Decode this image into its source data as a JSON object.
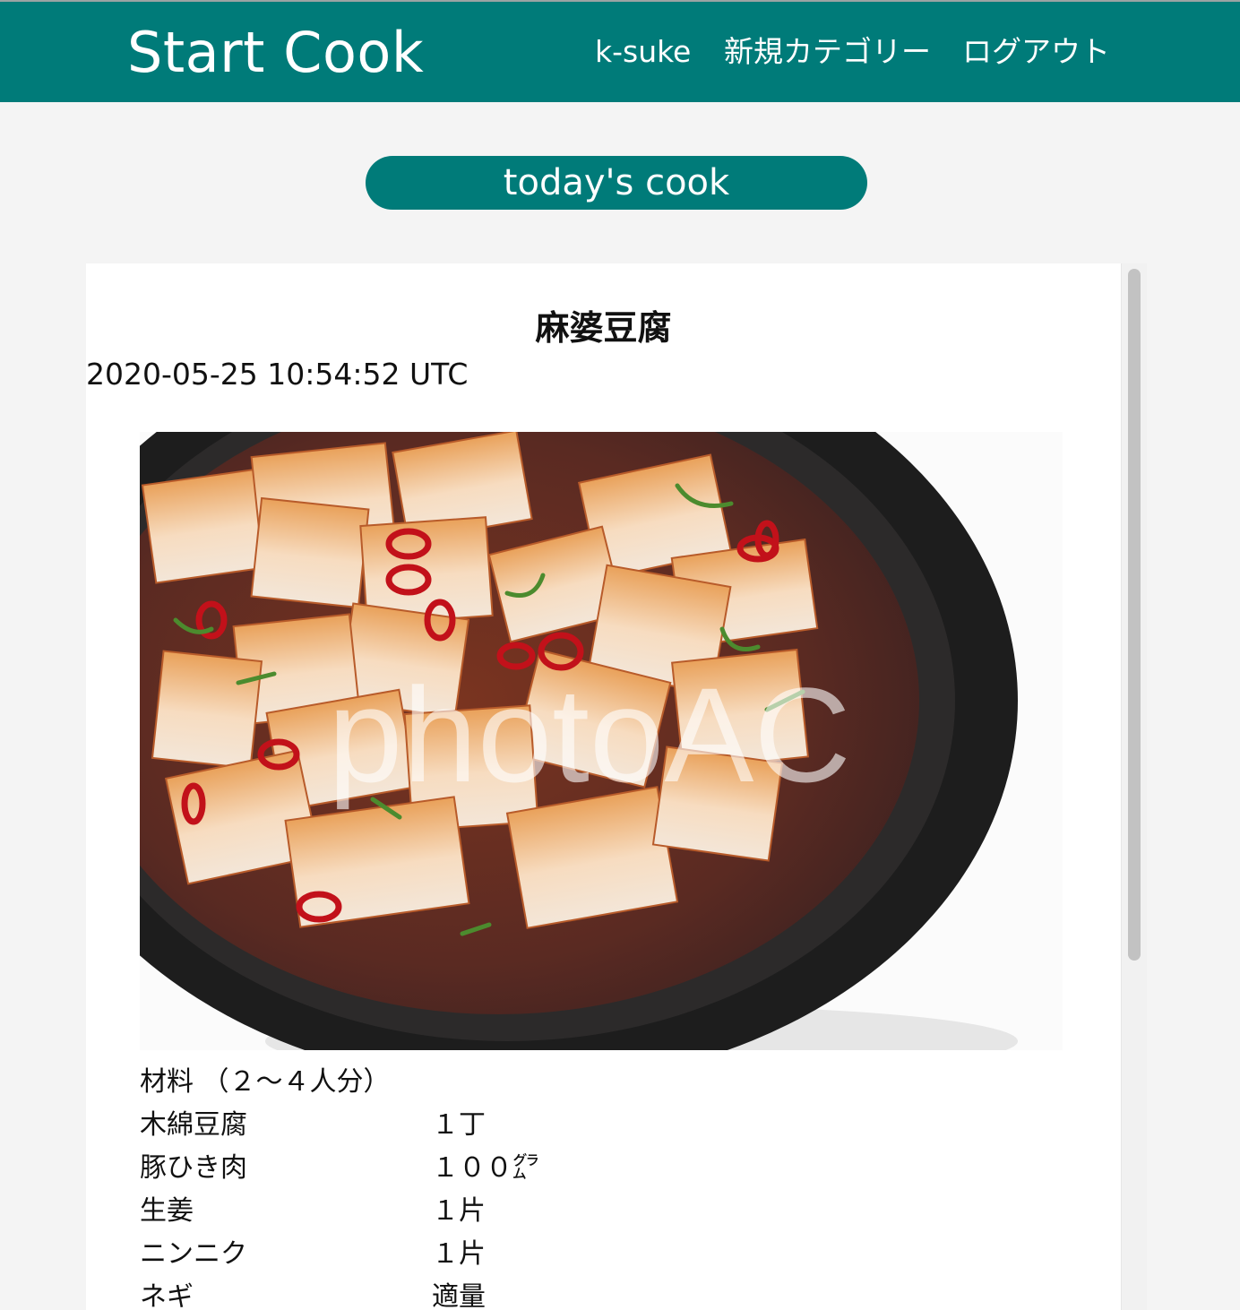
{
  "header": {
    "brand": "Start Cook",
    "nav": {
      "user": "k-suke",
      "new_category": "新規カテゴリー",
      "logout": "ログアウト"
    },
    "color": "#007b79"
  },
  "todays_cook_button": "today's cook",
  "post": {
    "title": "麻婆豆腐",
    "created_at": "2020-05-25 10:54:52 UTC",
    "image": {
      "alt": "麻婆豆腐",
      "watermark": "photoAC"
    },
    "ingredients_heading": "材料 （２～４人分）",
    "ingredients": [
      {
        "name": "木綿豆腐",
        "amount": "１丁"
      },
      {
        "name": "豚ひき肉",
        "amount": "１００㌘"
      },
      {
        "name": "生姜",
        "amount": "１片"
      },
      {
        "name": "ニンニク",
        "amount": "１片"
      },
      {
        "name": "ネギ",
        "amount": "適量"
      }
    ]
  }
}
